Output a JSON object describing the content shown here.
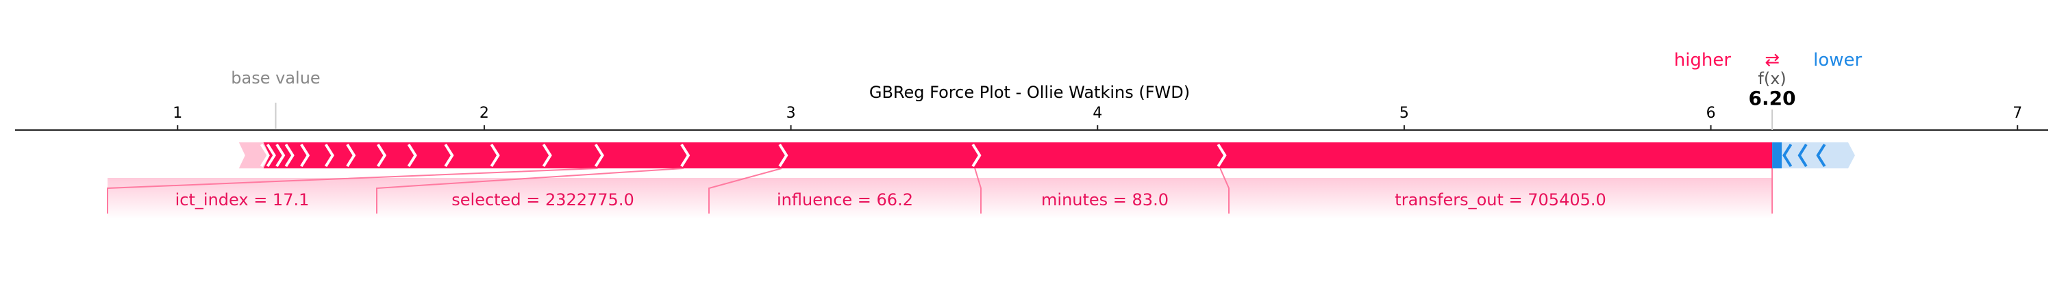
{
  "chart_data": {
    "type": "force",
    "title": "GBReg Force Plot - Ollie Watkins (FWD)",
    "base_value_label": "base value",
    "base_value": 1.32,
    "fx_label": "f(x)",
    "fx_value": 6.2,
    "fx_text": "6.20",
    "higher_label": "higher",
    "lower_label": "lower",
    "arrows_symbol": "⇄",
    "xlim": [
      0.47,
      7.1
    ],
    "ticks": [
      "1",
      "2",
      "3",
      "4",
      "5",
      "6",
      "7"
    ],
    "tick_values": [
      1,
      2,
      3,
      4,
      5,
      6,
      7
    ],
    "colors": {
      "positive": "#ff0d57",
      "negative": "#1e88e5",
      "positive_label": "#e8115a",
      "negative_label": "#1e88e5"
    },
    "positive_features": [
      {
        "label": "transfers_out = 705405.0",
        "start": 4.4,
        "end": 6.2
      },
      {
        "label": "minutes = 83.0",
        "start": 3.6,
        "end": 4.4
      },
      {
        "label": "influence = 66.2",
        "start": 2.97,
        "end": 3.6
      },
      {
        "label": "selected = 2322775.0",
        "start": 2.65,
        "end": 2.97
      },
      {
        "label": "ict_index = 17.1",
        "start": 2.37,
        "end": 2.65
      }
    ],
    "small_positive_segments": [
      2.2,
      2.03,
      1.88,
      1.76,
      1.66,
      1.56,
      1.49,
      1.41,
      1.36,
      1.33,
      1.3,
      1.28
    ],
    "negative_segments": [
      6.25,
      6.3,
      6.36,
      6.47
    ]
  }
}
